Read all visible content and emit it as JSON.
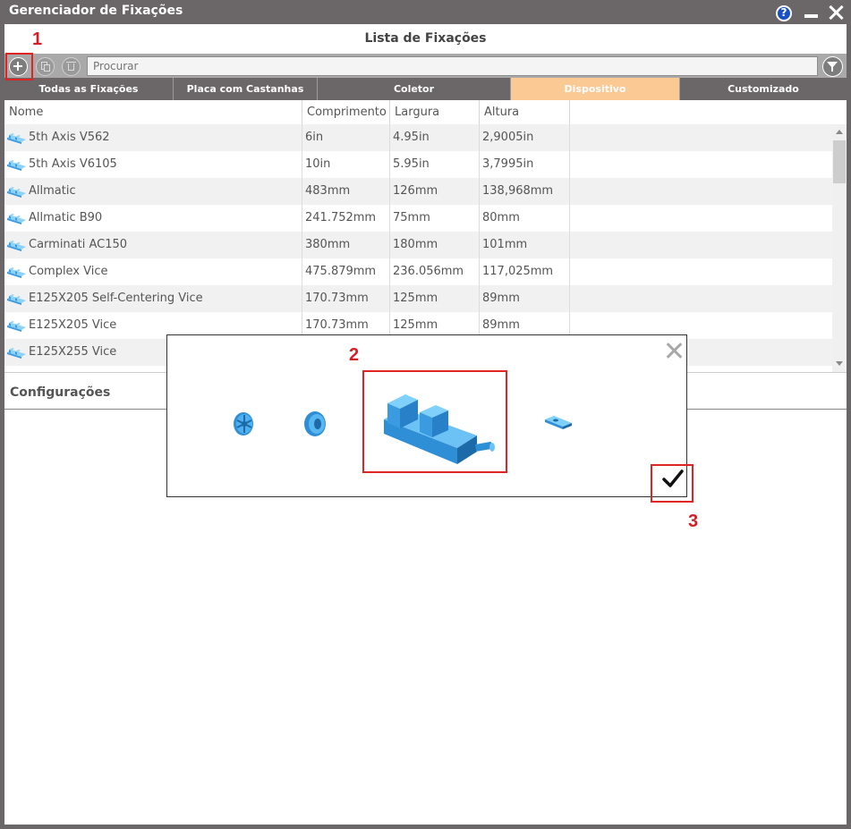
{
  "window": {
    "title": "Gerenciador de Fixações",
    "help_icon": "help-icon",
    "help_glyph": "?"
  },
  "list": {
    "title": "Lista de Fixações"
  },
  "toolbar": {
    "search_placeholder": "Procurar"
  },
  "tabs": [
    {
      "label": "Todas as Fixações",
      "active": false
    },
    {
      "label": "Placa com Castanhas",
      "active": false
    },
    {
      "label": "Coletor",
      "active": false
    },
    {
      "label": "Dispositivo",
      "active": true
    },
    {
      "label": "Customizado",
      "active": false
    }
  ],
  "table": {
    "columns": [
      "Nome",
      "Comprimento",
      "Largura",
      "Altura"
    ],
    "rows": [
      {
        "name": "5th Axis V562",
        "comprimento": "6in",
        "largura": "4.95in",
        "altura": "2,9005in"
      },
      {
        "name": "5th Axis V6105",
        "comprimento": "10in",
        "largura": "5.95in",
        "altura": "3,7995in"
      },
      {
        "name": "Allmatic",
        "comprimento": "483mm",
        "largura": "126mm",
        "altura": "138,968mm"
      },
      {
        "name": "Allmatic B90",
        "comprimento": "241.752mm",
        "largura": "75mm",
        "altura": "80mm"
      },
      {
        "name": "Carminati AC150",
        "comprimento": "380mm",
        "largura": "180mm",
        "altura": "101mm"
      },
      {
        "name": "Complex Vice",
        "comprimento": "475.879mm",
        "largura": "236.056mm",
        "altura": "117,025mm"
      },
      {
        "name": "E125X205 Self-Centering Vice",
        "comprimento": "170.73mm",
        "largura": "125mm",
        "altura": "89mm"
      },
      {
        "name": "E125X205 Vice",
        "comprimento": "170.73mm",
        "largura": "125mm",
        "altura": "89mm"
      },
      {
        "name": "E125X255 Vice",
        "comprimento": "",
        "largura": "",
        "altura": ""
      }
    ]
  },
  "config": {
    "title": "Configurações"
  },
  "annotations": {
    "step1": "1",
    "step2": "2",
    "step3": "3",
    "color": "#e02424"
  },
  "colors": {
    "titlebar": "#6b6668",
    "active_tab": "#fbc993",
    "icon_blue": "#3aa0e0"
  }
}
